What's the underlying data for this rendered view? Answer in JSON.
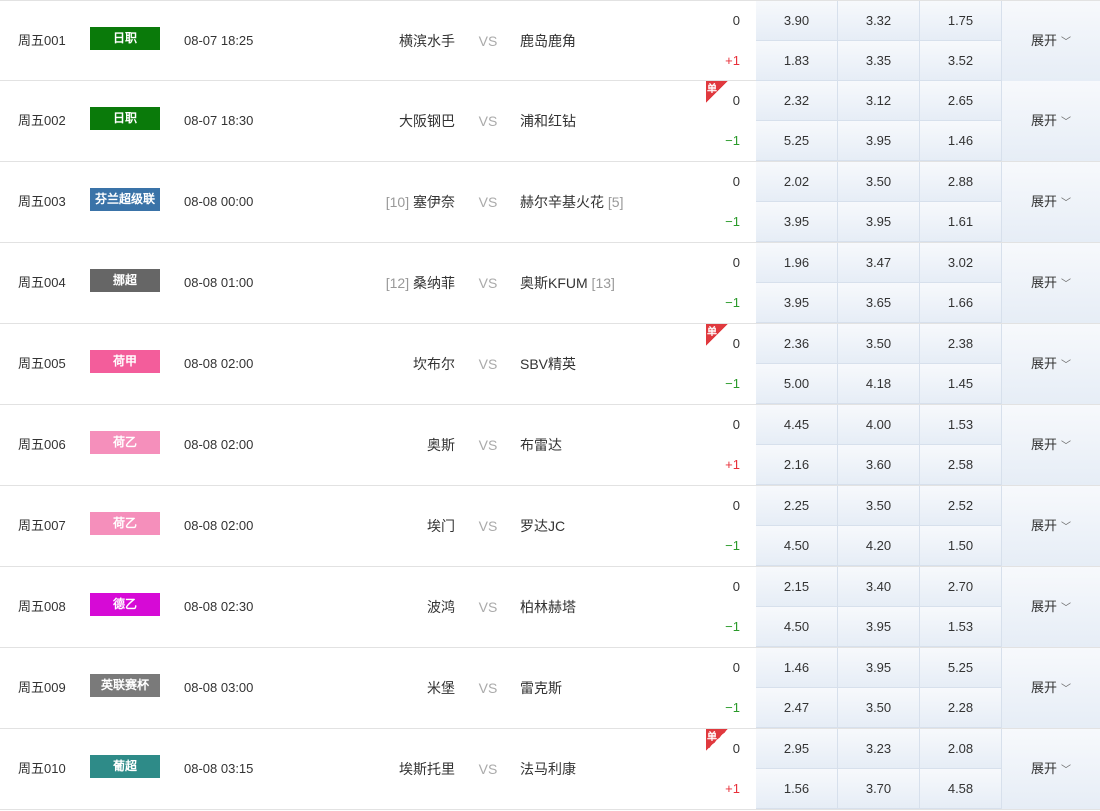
{
  "expand_label": "展开",
  "vs_label": "VS",
  "single_label": "单",
  "rows": [
    {
      "num": "周五001",
      "league": "日职",
      "league_color": "#0a7a0a",
      "time": "08-07 18:25",
      "home": "横滨水手",
      "home_rank": "",
      "away": "鹿岛鹿角",
      "away_rank": "",
      "hcap1": "0",
      "hcap2": "+1",
      "single": false,
      "odds1": [
        "3.90",
        "3.32",
        "1.75"
      ],
      "odds2": [
        "1.83",
        "3.35",
        "3.52"
      ]
    },
    {
      "num": "周五002",
      "league": "日职",
      "league_color": "#0a7a0a",
      "time": "08-07 18:30",
      "home": "大阪钢巴",
      "home_rank": "",
      "away": "浦和红钻",
      "away_rank": "",
      "hcap1": "0",
      "hcap2": "−1",
      "single": true,
      "odds1": [
        "2.32",
        "3.12",
        "2.65"
      ],
      "odds2": [
        "5.25",
        "3.95",
        "1.46"
      ]
    },
    {
      "num": "周五003",
      "league": "芬兰超级联",
      "league_color": "#3a73a8",
      "time": "08-08 00:00",
      "home": "塞伊奈",
      "home_rank": "[10]",
      "away": "赫尔辛基火花",
      "away_rank": "[5]",
      "hcap1": "0",
      "hcap2": "−1",
      "single": false,
      "odds1": [
        "2.02",
        "3.50",
        "2.88"
      ],
      "odds2": [
        "3.95",
        "3.95",
        "1.61"
      ]
    },
    {
      "num": "周五004",
      "league": "挪超",
      "league_color": "#666666",
      "time": "08-08 01:00",
      "home": "桑纳菲",
      "home_rank": "[12]",
      "away": "奥斯KFUM",
      "away_rank": "[13]",
      "hcap1": "0",
      "hcap2": "−1",
      "single": false,
      "odds1": [
        "1.96",
        "3.47",
        "3.02"
      ],
      "odds2": [
        "3.95",
        "3.65",
        "1.66"
      ]
    },
    {
      "num": "周五005",
      "league": "荷甲",
      "league_color": "#f35d9b",
      "time": "08-08 02:00",
      "home": "坎布尔",
      "home_rank": "",
      "away": "SBV精英",
      "away_rank": "",
      "hcap1": "0",
      "hcap2": "−1",
      "single": true,
      "odds1": [
        "2.36",
        "3.50",
        "2.38"
      ],
      "odds2": [
        "5.00",
        "4.18",
        "1.45"
      ]
    },
    {
      "num": "周五006",
      "league": "荷乙",
      "league_color": "#f58fbb",
      "time": "08-08 02:00",
      "home": "奥斯",
      "home_rank": "",
      "away": "布雷达",
      "away_rank": "",
      "hcap1": "0",
      "hcap2": "+1",
      "single": false,
      "odds1": [
        "4.45",
        "4.00",
        "1.53"
      ],
      "odds2": [
        "2.16",
        "3.60",
        "2.58"
      ]
    },
    {
      "num": "周五007",
      "league": "荷乙",
      "league_color": "#f58fbb",
      "time": "08-08 02:00",
      "home": "埃门",
      "home_rank": "",
      "away": "罗达JC",
      "away_rank": "",
      "hcap1": "0",
      "hcap2": "−1",
      "single": false,
      "odds1": [
        "2.25",
        "3.50",
        "2.52"
      ],
      "odds2": [
        "4.50",
        "4.20",
        "1.50"
      ]
    },
    {
      "num": "周五008",
      "league": "德乙",
      "league_color": "#d60ad6",
      "time": "08-08 02:30",
      "home": "波鸿",
      "home_rank": "",
      "away": "柏林赫塔",
      "away_rank": "",
      "hcap1": "0",
      "hcap2": "−1",
      "single": false,
      "odds1": [
        "2.15",
        "3.40",
        "2.70"
      ],
      "odds2": [
        "4.50",
        "3.95",
        "1.53"
      ]
    },
    {
      "num": "周五009",
      "league": "英联赛杯",
      "league_color": "#7a7a7a",
      "time": "08-08 03:00",
      "home": "米堡",
      "home_rank": "",
      "away": "雷克斯",
      "away_rank": "",
      "hcap1": "0",
      "hcap2": "−1",
      "single": false,
      "odds1": [
        "1.46",
        "3.95",
        "5.25"
      ],
      "odds2": [
        "2.47",
        "3.50",
        "2.28"
      ]
    },
    {
      "num": "周五010",
      "league": "葡超",
      "league_color": "#2e8b88",
      "time": "08-08 03:15",
      "home": "埃斯托里",
      "home_rank": "",
      "away": "法马利康",
      "away_rank": "",
      "hcap1": "0",
      "hcap2": "+1",
      "single": true,
      "odds1": [
        "2.95",
        "3.23",
        "2.08"
      ],
      "odds2": [
        "1.56",
        "3.70",
        "4.58"
      ]
    }
  ]
}
